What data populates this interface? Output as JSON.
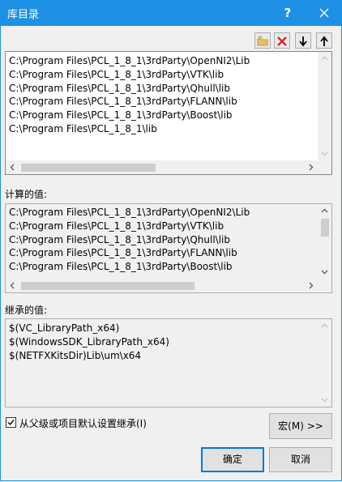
{
  "window": {
    "title": "库目录",
    "help": "?",
    "close_icon": "close-icon"
  },
  "toolbar": {
    "icons": [
      "new-folder-icon",
      "delete-icon",
      "move-down-icon",
      "move-up-icon"
    ]
  },
  "directories": [
    "C:\\Program Files\\PCL_1_8_1\\3rdParty\\OpenNI2\\Lib",
    "C:\\Program Files\\PCL_1_8_1\\3rdParty\\VTK\\lib",
    "C:\\Program Files\\PCL_1_8_1\\3rdParty\\Qhull\\lib",
    "C:\\Program Files\\PCL_1_8_1\\3rdParty\\FLANN\\lib",
    "C:\\Program Files\\PCL_1_8_1\\3rdParty\\Boost\\lib",
    "C:\\Program Files\\PCL_1_8_1\\lib"
  ],
  "evaluated": {
    "label": "计算的值:",
    "items": [
      "C:\\Program Files\\PCL_1_8_1\\3rdParty\\OpenNI2\\Lib",
      "C:\\Program Files\\PCL_1_8_1\\3rdParty\\VTK\\lib",
      "C:\\Program Files\\PCL_1_8_1\\3rdParty\\Qhull\\lib",
      "C:\\Program Files\\PCL_1_8_1\\3rdParty\\FLANN\\lib",
      "C:\\Program Files\\PCL_1_8_1\\3rdParty\\Boost\\lib"
    ]
  },
  "inherited": {
    "label": "继承的值:",
    "items": [
      "$(VC_LibraryPath_x64)",
      "$(WindowsSDK_LibraryPath_x64)",
      "$(NETFXKitsDir)Lib\\um\\x64"
    ]
  },
  "inherit_checkbox": {
    "label": "从父级或项目默认设置继承(I)",
    "checked": true
  },
  "buttons": {
    "macros": "宏(M) >>",
    "ok": "确定",
    "cancel": "取消"
  },
  "colors": {
    "titlebar": "#1e90e6",
    "accent": "#0078d7"
  }
}
